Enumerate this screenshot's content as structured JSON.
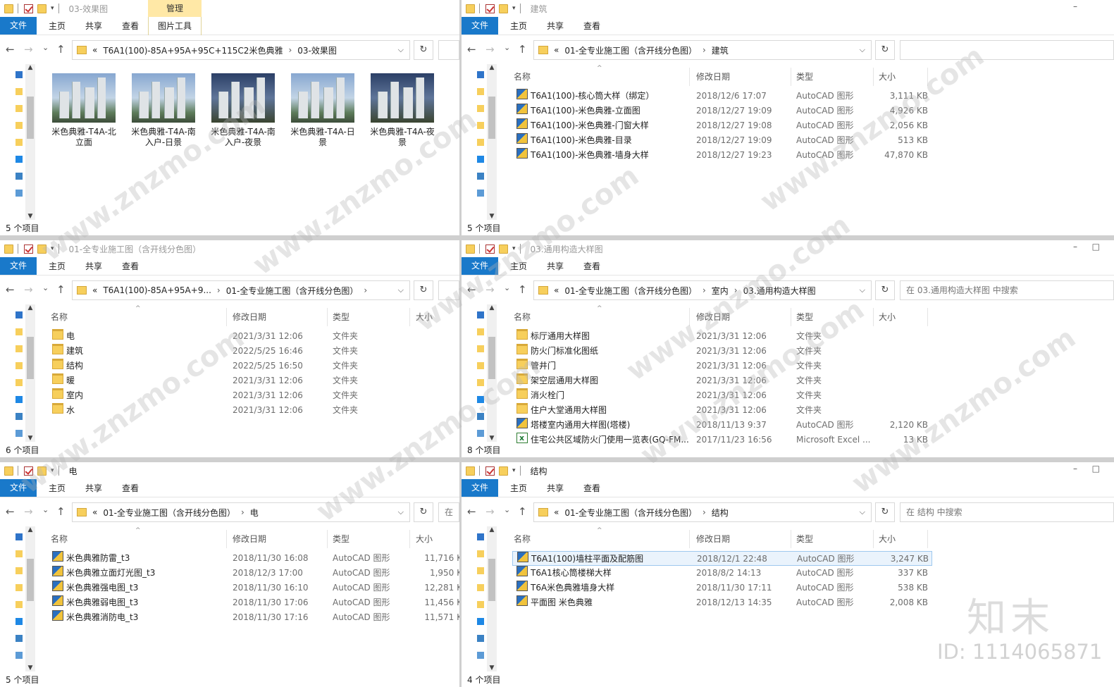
{
  "ribbon": {
    "file": "文件",
    "home": "主页",
    "share": "共享",
    "view": "查看",
    "manage": "管理",
    "picture_tools": "图片工具"
  },
  "search_prefix": "在",
  "w1": {
    "title": "03-效果图",
    "address": [
      "T6A1(100)-85A+95A+95C+115C2米色典雅",
      "03-效果图"
    ],
    "status": "5 个项目",
    "thumbs": [
      "米色典雅-T4A-北立面",
      "米色典雅-T4A-南入户-日景",
      "米色典雅-T4A-南入户-夜景",
      "米色典雅-T4A-日景",
      "米色典雅-T4A-夜景"
    ]
  },
  "w2": {
    "title": "建筑",
    "address": [
      "01-全专业施工图（含开线分色图）",
      "建筑"
    ],
    "cols": {
      "name": "名称",
      "date": "修改日期",
      "type": "类型",
      "size": "大小"
    },
    "status": "5 个项目",
    "rows": [
      {
        "name": "T6A1(100)-核心筒大样（绑定）",
        "date": "2018/12/6 17:07",
        "type": "AutoCAD 图形",
        "size": "3,111 KB",
        "icon": "cad"
      },
      {
        "name": "T6A1(100)-米色典雅-立面图",
        "date": "2018/12/27 19:09",
        "type": "AutoCAD 图形",
        "size": "4,926 KB",
        "icon": "cad"
      },
      {
        "name": "T6A1(100)-米色典雅-门窗大样",
        "date": "2018/12/27 19:08",
        "type": "AutoCAD 图形",
        "size": "2,056 KB",
        "icon": "cad"
      },
      {
        "name": "T6A1(100)-米色典雅-目录",
        "date": "2018/12/27 19:09",
        "type": "AutoCAD 图形",
        "size": "513 KB",
        "icon": "cad"
      },
      {
        "name": "T6A1(100)-米色典雅-墙身大样",
        "date": "2018/12/27 19:23",
        "type": "AutoCAD 图形",
        "size": "47,870 KB",
        "icon": "cad"
      }
    ]
  },
  "w3": {
    "title": "01-全专业施工图（含开线分色图）",
    "address": [
      "T6A1(100)-85A+95A+9...",
      "01-全专业施工图（含开线分色图）"
    ],
    "cols": {
      "name": "名称",
      "date": "修改日期",
      "type": "类型",
      "size": "大小"
    },
    "status": "6 个项目",
    "rows": [
      {
        "name": "电",
        "date": "2021/3/31 12:06",
        "type": "文件夹",
        "size": "",
        "icon": "folder"
      },
      {
        "name": "建筑",
        "date": "2022/5/25 16:46",
        "type": "文件夹",
        "size": "",
        "icon": "folder"
      },
      {
        "name": "结构",
        "date": "2022/5/25 16:50",
        "type": "文件夹",
        "size": "",
        "icon": "folder"
      },
      {
        "name": "暖",
        "date": "2021/3/31 12:06",
        "type": "文件夹",
        "size": "",
        "icon": "folder"
      },
      {
        "name": "室内",
        "date": "2021/3/31 12:06",
        "type": "文件夹",
        "size": "",
        "icon": "folder"
      },
      {
        "name": "水",
        "date": "2021/3/31 12:06",
        "type": "文件夹",
        "size": "",
        "icon": "folder"
      }
    ]
  },
  "w4": {
    "title": "03.通用构造大样图",
    "address": [
      "01-全专业施工图（含开线分色图）",
      "室内",
      "03.通用构造大样图"
    ],
    "search_placeholder": "在 03.通用构造大样图 中搜索",
    "cols": {
      "name": "名称",
      "date": "修改日期",
      "type": "类型",
      "size": "大小"
    },
    "status": "8 个项目",
    "rows": [
      {
        "name": "标厅通用大样图",
        "date": "2021/3/31 12:06",
        "type": "文件夹",
        "size": "",
        "icon": "folder"
      },
      {
        "name": "防火门标准化图纸",
        "date": "2021/3/31 12:06",
        "type": "文件夹",
        "size": "",
        "icon": "folder"
      },
      {
        "name": "管井门",
        "date": "2021/3/31 12:06",
        "type": "文件夹",
        "size": "",
        "icon": "folder"
      },
      {
        "name": "架空层通用大样图",
        "date": "2021/3/31 12:06",
        "type": "文件夹",
        "size": "",
        "icon": "folder"
      },
      {
        "name": "消火栓门",
        "date": "2021/3/31 12:06",
        "type": "文件夹",
        "size": "",
        "icon": "folder"
      },
      {
        "name": "住户大堂通用大样图",
        "date": "2021/3/31 12:06",
        "type": "文件夹",
        "size": "",
        "icon": "folder"
      },
      {
        "name": "塔楼室内通用大样图(塔楼)",
        "date": "2018/11/13 9:37",
        "type": "AutoCAD 图形",
        "size": "2,120 KB",
        "icon": "cad"
      },
      {
        "name": "住宅公共区域防火门使用一览表(GQ-FM...",
        "date": "2017/11/23 16:56",
        "type": "Microsoft Excel ...",
        "size": "13 KB",
        "icon": "xls"
      }
    ]
  },
  "w5": {
    "title": "电",
    "address": [
      "01-全专业施工图（含开线分色图）",
      "电"
    ],
    "cols": {
      "name": "名称",
      "date": "修改日期",
      "type": "类型",
      "size": "大小"
    },
    "status": "5 个项目",
    "rows": [
      {
        "name": "米色典雅防雷_t3",
        "date": "2018/11/30 16:08",
        "type": "AutoCAD 图形",
        "size": "11,716 K",
        "icon": "cad"
      },
      {
        "name": "米色典雅立面灯光图_t3",
        "date": "2018/12/3 17:00",
        "type": "AutoCAD 图形",
        "size": "1,950 K",
        "icon": "cad"
      },
      {
        "name": "米色典雅强电图_t3",
        "date": "2018/11/30 16:10",
        "type": "AutoCAD 图形",
        "size": "12,281 K",
        "icon": "cad"
      },
      {
        "name": "米色典雅弱电图_t3",
        "date": "2018/11/30 17:06",
        "type": "AutoCAD 图形",
        "size": "11,456 K",
        "icon": "cad"
      },
      {
        "name": "米色典雅消防电_t3",
        "date": "2018/11/30 17:16",
        "type": "AutoCAD 图形",
        "size": "11,571 K",
        "icon": "cad"
      }
    ]
  },
  "w6": {
    "title": "结构",
    "address": [
      "01-全专业施工图（含开线分色图）",
      "结构"
    ],
    "search_placeholder": "在 结构 中搜索",
    "cols": {
      "name": "名称",
      "date": "修改日期",
      "type": "类型",
      "size": "大小"
    },
    "status": "4 个项目",
    "rows": [
      {
        "name": "T6A1(100)墙柱平面及配筋图",
        "date": "2018/12/1 22:48",
        "type": "AutoCAD 图形",
        "size": "3,247 KB",
        "icon": "cad"
      },
      {
        "name": "T6A1核心筒楼梯大样",
        "date": "2018/8/2 14:13",
        "type": "AutoCAD 图形",
        "size": "337 KB",
        "icon": "cad"
      },
      {
        "name": "T6A米色典雅墙身大样",
        "date": "2018/11/30 17:11",
        "type": "AutoCAD 图形",
        "size": "538 KB",
        "icon": "cad"
      },
      {
        "name": "平面图 米色典雅",
        "date": "2018/12/13 14:35",
        "type": "AutoCAD 图形",
        "size": "2,008 KB",
        "icon": "cad"
      }
    ]
  },
  "watermark": {
    "brand": "知末",
    "id": "ID: 1114065871",
    "url": "www.znzmo.com"
  },
  "colors": {
    "ribbon_file": "#1979ca",
    "manage_tab": "#ffe8a6",
    "selected_row": "#eaf3fc",
    "folder": "#f7cf5c"
  }
}
